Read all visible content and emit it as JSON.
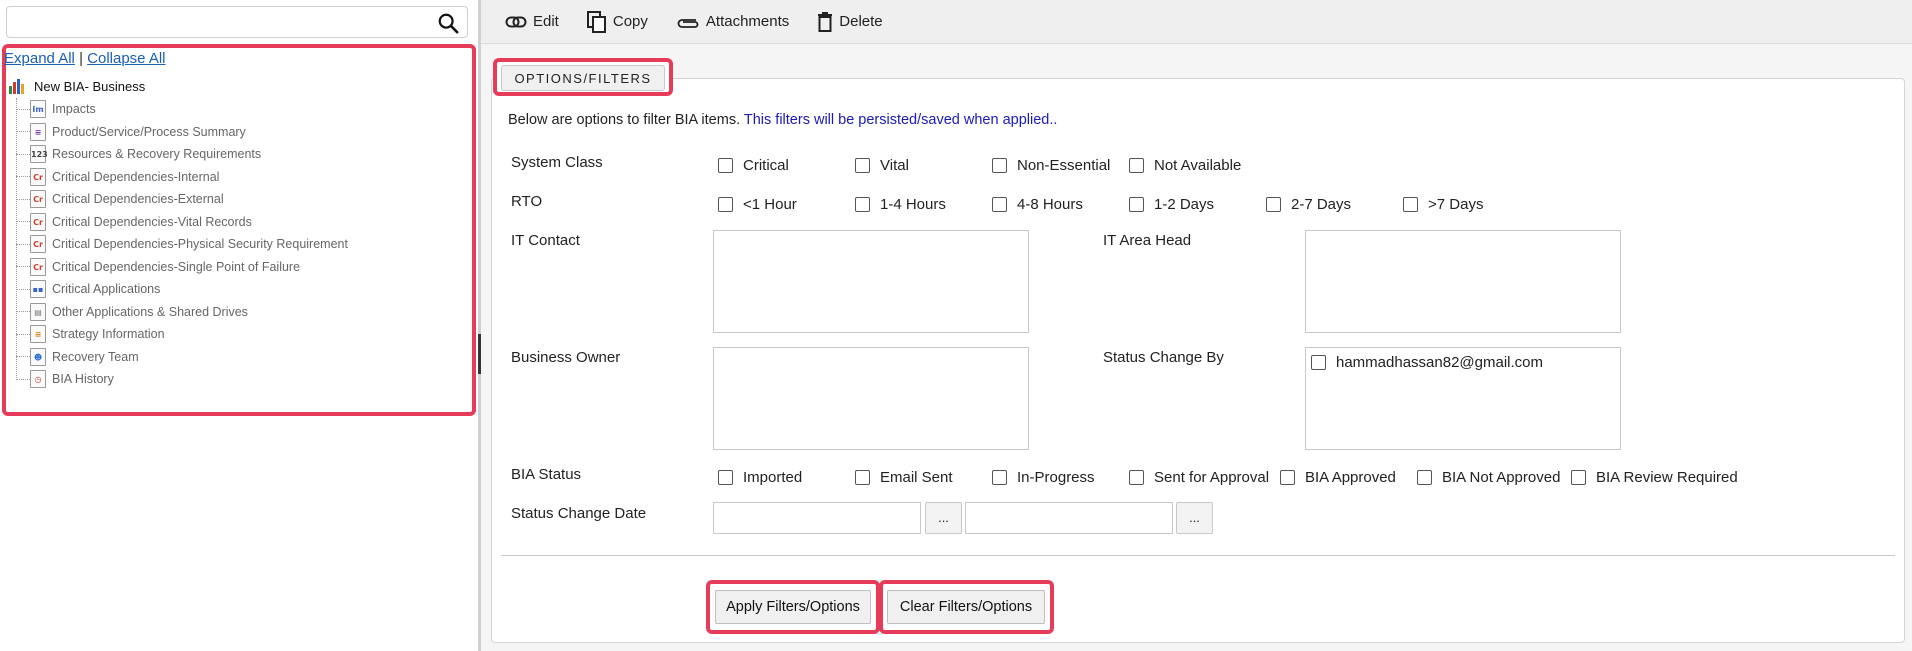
{
  "colors": {
    "highlight_frame": "#e63c5a",
    "link": "#1a5fb4",
    "note_blue": "#1a1ab5"
  },
  "sidebar": {
    "search": {
      "placeholder": "",
      "value": ""
    },
    "expand_all": "Expand All",
    "separator": "|",
    "collapse_all": "Collapse All",
    "root": {
      "label": "New BIA- Business",
      "icon": "chart-bars-icon"
    },
    "items": [
      {
        "label": "Impacts",
        "badge": "Im",
        "color": "#3b64c4"
      },
      {
        "label": "Product/Service/Process Summary",
        "badge": "≡",
        "color": "#7b3fa0"
      },
      {
        "label": "Resources & Recovery Requirements",
        "badge": "123",
        "color": "#444444"
      },
      {
        "label": "Critical Dependencies-Internal",
        "badge": "Cr",
        "color": "#c8412c"
      },
      {
        "label": "Critical Dependencies-External",
        "badge": "Cr",
        "color": "#c8412c"
      },
      {
        "label": "Critical Dependencies-Vital Records",
        "badge": "Cr",
        "color": "#c8412c"
      },
      {
        "label": "Critical Dependencies-Physical Security Requirement",
        "badge": "Cr",
        "color": "#c8412c"
      },
      {
        "label": "Critical Dependencies-Single Point of Failure",
        "badge": "Cr",
        "color": "#c8412c"
      },
      {
        "label": "Critical Applications",
        "badge": "▪▪",
        "color": "#3b64c4"
      },
      {
        "label": "Other Applications & Shared Drives",
        "badge": "▤",
        "color": "#777777"
      },
      {
        "label": "Strategy Information",
        "badge": "≡",
        "color": "#d48a1c"
      },
      {
        "label": "Recovery Team",
        "badge": "☻",
        "color": "#2a6fd0"
      },
      {
        "label": "BIA History",
        "badge": "◷",
        "color": "#c8412c"
      }
    ]
  },
  "toolbar": {
    "edit": "Edit",
    "copy": "Copy",
    "attachments": "Attachments",
    "delete": "Delete"
  },
  "filters": {
    "legend": "OPTIONS/FILTERS",
    "desc_main": "Below are options to filter BIA items. ",
    "desc_note": "This filters will be persisted/saved when applied..",
    "system_class": {
      "label": "System Class",
      "options": [
        "Critical",
        "Vital",
        "Non-Essential",
        "Not Available"
      ]
    },
    "rto": {
      "label": "RTO",
      "options": [
        "<1 Hour",
        "1-4 Hours",
        "4-8 Hours",
        "1-2 Days",
        "2-7 Days",
        ">7 Days"
      ]
    },
    "it_contact": "IT Contact",
    "it_area_head": "IT Area Head",
    "business_owner": "Business Owner",
    "status_change_by": {
      "label": "Status Change By",
      "options": [
        "hammadhassan82@gmail.com"
      ]
    },
    "bia_status": {
      "label": "BIA Status",
      "options": [
        "Imported",
        "Email Sent",
        "In-Progress",
        "Sent for Approval",
        "BIA Approved",
        "BIA Not Approved",
        "BIA Review Required"
      ]
    },
    "status_change_date": {
      "label": "Status Change Date",
      "picker": "...",
      "from": "",
      "to": ""
    },
    "apply": "Apply Filters/Options",
    "clear": "Clear Filters/Options"
  }
}
